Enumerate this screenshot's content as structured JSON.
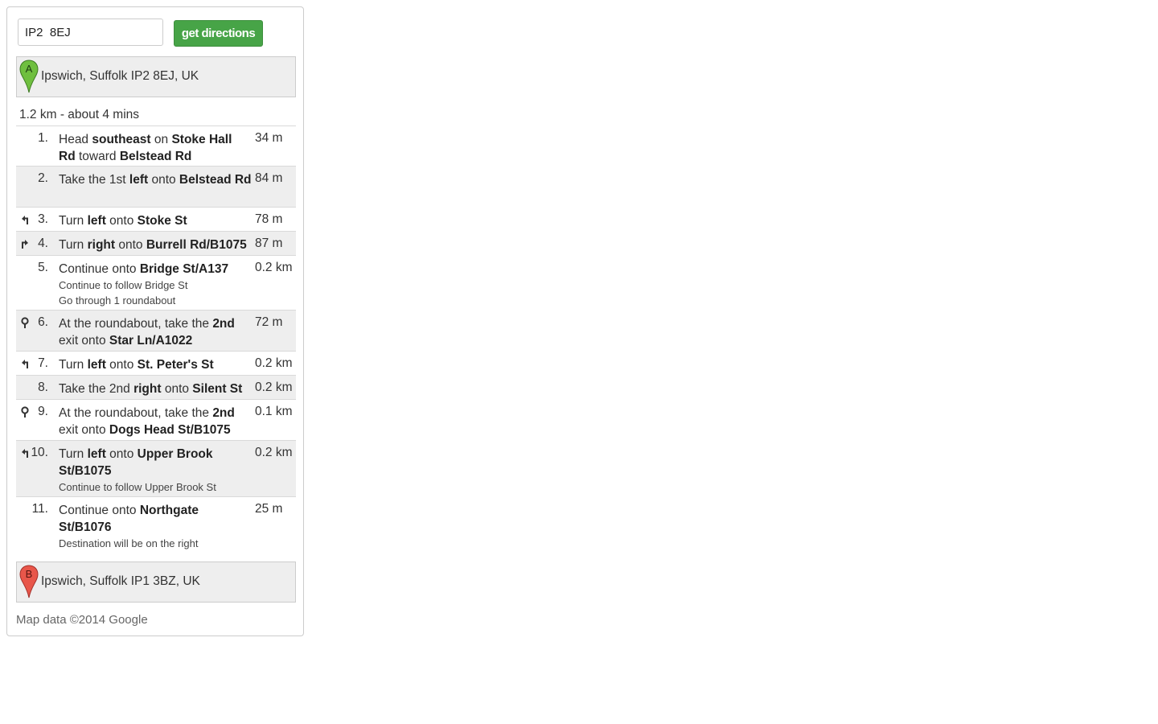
{
  "search": {
    "value": "IP2  8EJ",
    "button_label": "get directions"
  },
  "origin": {
    "marker_letter": "A",
    "address": "Ipswich, Suffolk IP2 8EJ, UK",
    "marker_color": "#6fbf3f"
  },
  "summary": "1.2 km - about 4 mins",
  "steps": [
    {
      "num": "1.",
      "icon": "",
      "parts": [
        [
          "Head ",
          false
        ],
        [
          "southeast",
          true
        ],
        [
          " on ",
          false
        ],
        [
          "Stoke Hall Rd",
          true
        ],
        [
          " toward ",
          false
        ],
        [
          "Belstead Rd",
          true
        ]
      ],
      "subs": [],
      "dist": "34 m"
    },
    {
      "num": "2.",
      "icon": "",
      "parts": [
        [
          "Take the 1st ",
          false
        ],
        [
          "left",
          true
        ],
        [
          " onto ",
          false
        ],
        [
          "Belstead Rd",
          true
        ]
      ],
      "subs": [],
      "dist": "84 m"
    },
    {
      "num": "3.",
      "icon": "turn-left-icon",
      "parts": [
        [
          "Turn ",
          false
        ],
        [
          "left",
          true
        ],
        [
          " onto ",
          false
        ],
        [
          "Stoke St",
          true
        ]
      ],
      "subs": [],
      "dist": "78 m"
    },
    {
      "num": "4.",
      "icon": "turn-right-icon",
      "parts": [
        [
          "Turn ",
          false
        ],
        [
          "right",
          true
        ],
        [
          " onto ",
          false
        ],
        [
          "Burrell Rd/B1075",
          true
        ]
      ],
      "subs": [],
      "dist": "87 m"
    },
    {
      "num": "5.",
      "icon": "",
      "parts": [
        [
          "Continue onto ",
          false
        ],
        [
          "Bridge St/A137",
          true
        ]
      ],
      "subs": [
        "Continue to follow Bridge St",
        "Go through 1 roundabout"
      ],
      "dist": "0.2 km"
    },
    {
      "num": "6.",
      "icon": "roundabout-icon",
      "parts": [
        [
          "At the roundabout, take the ",
          false
        ],
        [
          "2nd",
          true
        ],
        [
          " exit onto ",
          false
        ],
        [
          "Star Ln/A1022",
          true
        ]
      ],
      "subs": [],
      "dist": "72 m"
    },
    {
      "num": "7.",
      "icon": "turn-left-icon",
      "parts": [
        [
          "Turn ",
          false
        ],
        [
          "left",
          true
        ],
        [
          " onto ",
          false
        ],
        [
          "St. Peter's St",
          true
        ]
      ],
      "subs": [],
      "dist": "0.2 km"
    },
    {
      "num": "8.",
      "icon": "",
      "parts": [
        [
          "Take the 2nd ",
          false
        ],
        [
          "right",
          true
        ],
        [
          " onto ",
          false
        ],
        [
          "Silent St",
          true
        ]
      ],
      "subs": [],
      "dist": "0.2 km"
    },
    {
      "num": "9.",
      "icon": "roundabout-icon",
      "parts": [
        [
          "At the roundabout, take the ",
          false
        ],
        [
          "2nd",
          true
        ],
        [
          " exit onto ",
          false
        ],
        [
          "Dogs Head St/B1075",
          true
        ]
      ],
      "subs": [],
      "dist": "0.1 km"
    },
    {
      "num": "10.",
      "icon": "turn-left-icon",
      "parts": [
        [
          "Turn ",
          false
        ],
        [
          "left",
          true
        ],
        [
          " onto ",
          false
        ],
        [
          "Upper Brook St/B1075",
          true
        ]
      ],
      "subs": [
        "Continue to follow Upper Brook St"
      ],
      "dist": "0.2 km"
    },
    {
      "num": "11.",
      "icon": "",
      "parts": [
        [
          "Continue onto ",
          false
        ],
        [
          "Northgate St/B1076",
          true
        ]
      ],
      "subs": [
        "Destination will be on the right"
      ],
      "dist": "25 m"
    }
  ],
  "destination": {
    "marker_letter": "B",
    "address": "Ipswich, Suffolk IP1 3BZ, UK",
    "marker_color": "#e8564a"
  },
  "copyright": "Map data ©2014 Google"
}
